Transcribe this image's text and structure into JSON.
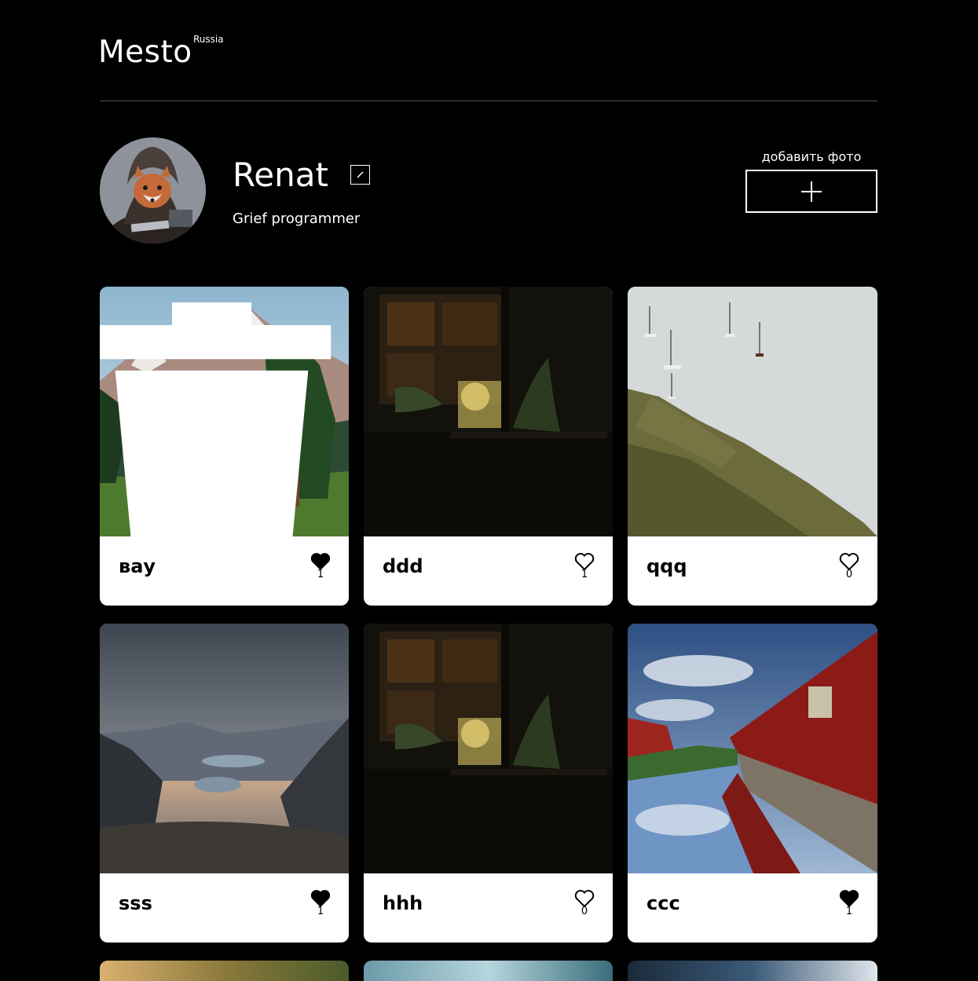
{
  "header": {
    "logo": "Mesto",
    "logo_sub": "Russia"
  },
  "profile": {
    "name": "Renat",
    "about": "Grief programmer",
    "add_label": "добавить фото"
  },
  "cards": [
    {
      "title": "вау",
      "likes": "1",
      "liked": true,
      "deletable": true,
      "image": "mountain-lake"
    },
    {
      "title": "ddd",
      "likes": "1",
      "liked": false,
      "deletable": false,
      "image": "aquarium-room"
    },
    {
      "title": "qqq",
      "likes": "0",
      "liked": false,
      "deletable": false,
      "image": "coast-sailboats"
    },
    {
      "title": "sss",
      "likes": "1",
      "liked": true,
      "deletable": false,
      "image": "mountain-valley"
    },
    {
      "title": "hhh",
      "likes": "0",
      "liked": false,
      "deletable": false,
      "image": "aquarium-room"
    },
    {
      "title": "ccc",
      "likes": "1",
      "liked": true,
      "deletable": false,
      "image": "red-houses-canal"
    }
  ],
  "colors": {
    "background": "#000000",
    "card": "#ffffff",
    "divider": "#545454"
  }
}
